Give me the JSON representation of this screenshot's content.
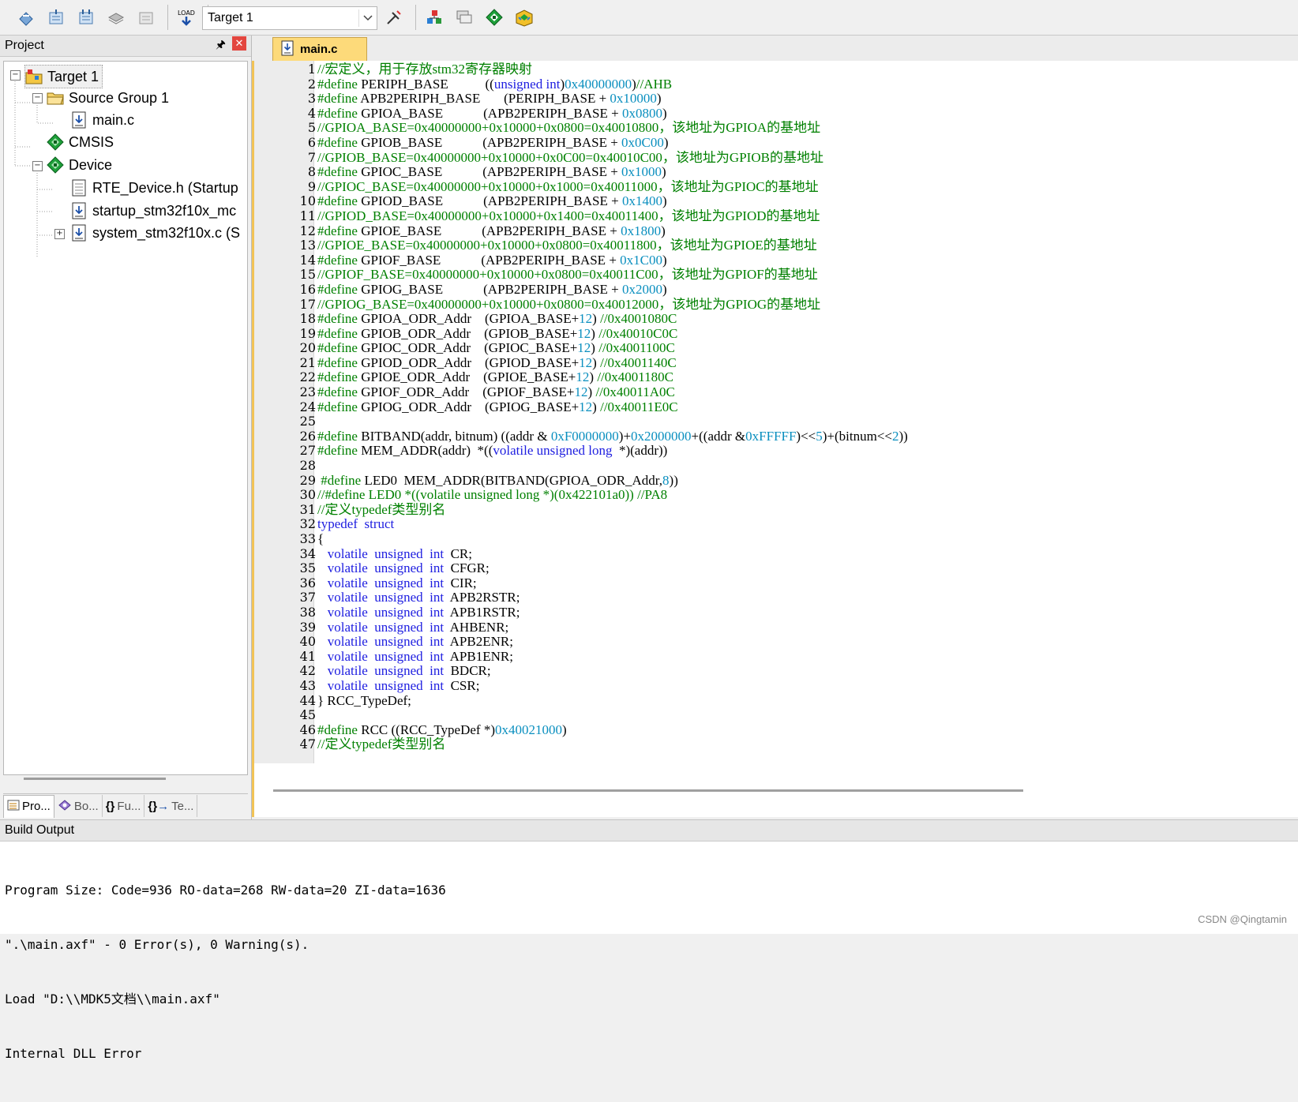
{
  "toolbar": {
    "target_select": "Target 1",
    "buttons": [
      "translate-icon",
      "build-icon",
      "rebuild-icon",
      "batch-build-icon",
      "stop-build-icon",
      "download-icon",
      "target-options-icon",
      "manage-project-items-icon",
      "select-packs-icon",
      "manage-rte-icon",
      "pack-installer-icon"
    ]
  },
  "project_panel": {
    "title": "Project",
    "tree": [
      {
        "label": "Target 1",
        "icon": "target-folder-icon",
        "level": 0
      },
      {
        "label": "Source Group 1",
        "icon": "folder-icon",
        "level": 1
      },
      {
        "label": "main.c",
        "icon": "c-file-icon",
        "level": 2
      },
      {
        "label": "CMSIS",
        "icon": "rte-component-icon",
        "level": 1
      },
      {
        "label": "Device",
        "icon": "rte-component-icon",
        "level": 1
      },
      {
        "label": "RTE_Device.h (Startup",
        "icon": "header-file-icon",
        "level": 2
      },
      {
        "label": "startup_stm32f10x_mc",
        "icon": "asm-file-icon",
        "level": 2
      },
      {
        "label": "system_stm32f10x.c (S",
        "icon": "c-file-icon",
        "level": 2
      }
    ],
    "bottom_tabs": [
      "Pro...",
      "Bo...",
      "Fu...",
      "Te..."
    ]
  },
  "editor": {
    "active_tab": "main.c",
    "lines": [
      "//宏定义，用于存放stm32寄存器映射",
      "#define PERIPH_BASE           ((unsigned int)0x40000000)//AHB",
      "#define APB2PERIPH_BASE       (PERIPH_BASE + 0x10000)",
      "#define GPIOA_BASE            (APB2PERIPH_BASE + 0x0800)",
      "//GPIOA_BASE=0x40000000+0x10000+0x0800=0x40010800，该地址为GPIOA的基地址",
      "#define GPIOB_BASE            (APB2PERIPH_BASE + 0x0C00)",
      "//GPIOB_BASE=0x40000000+0x10000+0x0C00=0x40010C00，该地址为GPIOB的基地址",
      "#define GPIOC_BASE            (APB2PERIPH_BASE + 0x1000)",
      "//GPIOC_BASE=0x40000000+0x10000+0x1000=0x40011000，该地址为GPIOC的基地址",
      "#define GPIOD_BASE            (APB2PERIPH_BASE + 0x1400)",
      "//GPIOD_BASE=0x40000000+0x10000+0x1400=0x40011400，该地址为GPIOD的基地址",
      "#define GPIOE_BASE            (APB2PERIPH_BASE + 0x1800)",
      "//GPIOE_BASE=0x40000000+0x10000+0x0800=0x40011800，该地址为GPIOE的基地址",
      "#define GPIOF_BASE            (APB2PERIPH_BASE + 0x1C00)",
      "//GPIOF_BASE=0x40000000+0x10000+0x0800=0x40011C00，该地址为GPIOF的基地址",
      "#define GPIOG_BASE            (APB2PERIPH_BASE + 0x2000)",
      "//GPIOG_BASE=0x40000000+0x10000+0x0800=0x40012000，该地址为GPIOG的基地址",
      "#define GPIOA_ODR_Addr    (GPIOA_BASE+12) //0x4001080C",
      "#define GPIOB_ODR_Addr    (GPIOB_BASE+12) //0x40010C0C",
      "#define GPIOC_ODR_Addr    (GPIOC_BASE+12) //0x4001100C",
      "#define GPIOD_ODR_Addr    (GPIOD_BASE+12) //0x4001140C",
      "#define GPIOE_ODR_Addr    (GPIOE_BASE+12) //0x4001180C",
      "#define GPIOF_ODR_Addr    (GPIOF_BASE+12) //0x40011A0C",
      "#define GPIOG_ODR_Addr    (GPIOG_BASE+12) //0x40011E0C",
      "",
      "#define BITBAND(addr, bitnum) ((addr & 0xF0000000)+0x2000000+((addr &0xFFFFF)<<5)+(bitnum<<2))",
      "#define MEM_ADDR(addr)  *((volatile unsigned long  *)(addr))",
      "",
      " #define LED0  MEM_ADDR(BITBAND(GPIOA_ODR_Addr,8))",
      "//#define LED0 *((volatile unsigned long *)(0x422101a0)) //PA8",
      "//定义typedef类型别名",
      "typedef  struct",
      "{",
      "   volatile  unsigned  int  CR;",
      "   volatile  unsigned  int  CFGR;",
      "   volatile  unsigned  int  CIR;",
      "   volatile  unsigned  int  APB2RSTR;",
      "   volatile  unsigned  int  APB1RSTR;",
      "   volatile  unsigned  int  AHBENR;",
      "   volatile  unsigned  int  APB2ENR;",
      "   volatile  unsigned  int  APB1ENR;",
      "   volatile  unsigned  int  BDCR;",
      "   volatile  unsigned  int  CSR;",
      "} RCC_TypeDef;",
      "",
      "#define RCC ((RCC_TypeDef *)0x40021000)",
      "//定义typedef类型别名"
    ]
  },
  "build_output": {
    "title": "Build Output",
    "lines": [
      "Program Size: Code=936 RO-data=268 RW-data=20 ZI-data=1636",
      "\".\\main.axf\" - 0 Error(s), 0 Warning(s).",
      "Load \"D:\\\\MDK5文档\\\\main.axf\"",
      "Internal DLL Error"
    ]
  },
  "watermark": "CSDN @Qingtamin",
  "colors": {
    "keyword": "#1d1de0",
    "comment": "#008000",
    "number": "#0a8fbf",
    "tab_active": "#fdda7a"
  }
}
